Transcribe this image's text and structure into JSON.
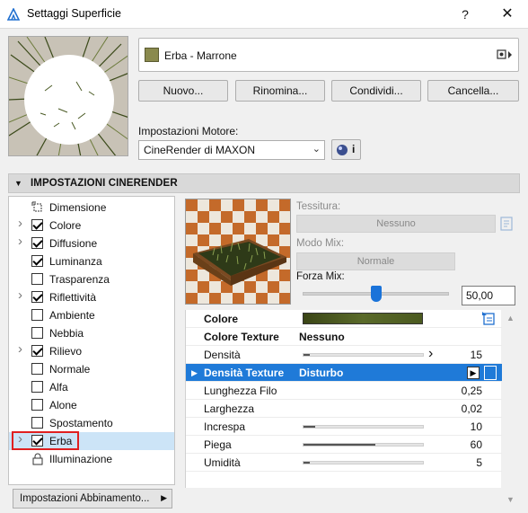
{
  "window": {
    "title": "Settaggi Superficie",
    "help_label": "?",
    "close_label": "✕"
  },
  "surface": {
    "name": "Erba - Marrone",
    "swatch_color": "#8a8a4e"
  },
  "buttons": {
    "new": "Nuovo...",
    "rename": "Rinomina...",
    "share": "Condividi...",
    "delete": "Cancella..."
  },
  "engine": {
    "label": "Impostazioni Motore:",
    "selected": "CineRender di MAXON",
    "info_label": "i"
  },
  "section": {
    "title": "IMPOSTAZIONI CINERENDER"
  },
  "channels": [
    {
      "label": "Dimensione",
      "checkbox": false,
      "checked": false,
      "expandable": false,
      "icon": "dimension-icon"
    },
    {
      "label": "Colore",
      "checkbox": true,
      "checked": true,
      "expandable": true
    },
    {
      "label": "Diffusione",
      "checkbox": true,
      "checked": true,
      "expandable": true
    },
    {
      "label": "Luminanza",
      "checkbox": true,
      "checked": true,
      "expandable": false
    },
    {
      "label": "Trasparenza",
      "checkbox": true,
      "checked": false,
      "expandable": false
    },
    {
      "label": "Riflettività",
      "checkbox": true,
      "checked": true,
      "expandable": true
    },
    {
      "label": "Ambiente",
      "checkbox": true,
      "checked": false,
      "expandable": false
    },
    {
      "label": "Nebbia",
      "checkbox": true,
      "checked": false,
      "expandable": false
    },
    {
      "label": "Rilievo",
      "checkbox": true,
      "checked": true,
      "expandable": true
    },
    {
      "label": "Normale",
      "checkbox": true,
      "checked": false,
      "expandable": false
    },
    {
      "label": "Alfa",
      "checkbox": true,
      "checked": false,
      "expandable": false
    },
    {
      "label": "Alone",
      "checkbox": true,
      "checked": false,
      "expandable": false
    },
    {
      "label": "Spostamento",
      "checkbox": true,
      "checked": false,
      "expandable": false
    },
    {
      "label": "Erba",
      "checkbox": true,
      "checked": true,
      "expandable": true,
      "selected": true
    },
    {
      "label": "Illuminazione",
      "checkbox": false,
      "checked": false,
      "expandable": false,
      "icon": "lock-icon"
    }
  ],
  "footer": {
    "match_settings": "Impostazioni Abbinamento..."
  },
  "texture": {
    "label": "Tessitura:",
    "value": "Nessuno"
  },
  "mix": {
    "mode_label": "Modo Mix:",
    "mode_value": "Normale",
    "strength_label": "Forza Mix:",
    "strength_value": "50,00",
    "strength_fraction": 0.5
  },
  "params": [
    {
      "label": "Colore",
      "bold": true,
      "type": "color",
      "color": "#4b5a20"
    },
    {
      "label": "Colore Texture",
      "bold": true,
      "type": "text",
      "text": "Nessuno"
    },
    {
      "label": "Densità",
      "type": "bar",
      "fraction": 0.05,
      "value": "15"
    },
    {
      "label": "Densità Texture",
      "bold": true,
      "type": "text",
      "text": "Disturbo",
      "selected": true
    },
    {
      "label": "Lunghezza Filo",
      "type": "value",
      "value": "0,25"
    },
    {
      "label": "Larghezza",
      "type": "value",
      "value": "0,02"
    },
    {
      "label": "Increspa",
      "type": "bar",
      "fraction": 0.1,
      "value": "10"
    },
    {
      "label": "Piega",
      "type": "bar",
      "fraction": 0.6,
      "value": "60"
    },
    {
      "label": "Umidità",
      "type": "bar",
      "fraction": 0.05,
      "value": "5"
    }
  ]
}
